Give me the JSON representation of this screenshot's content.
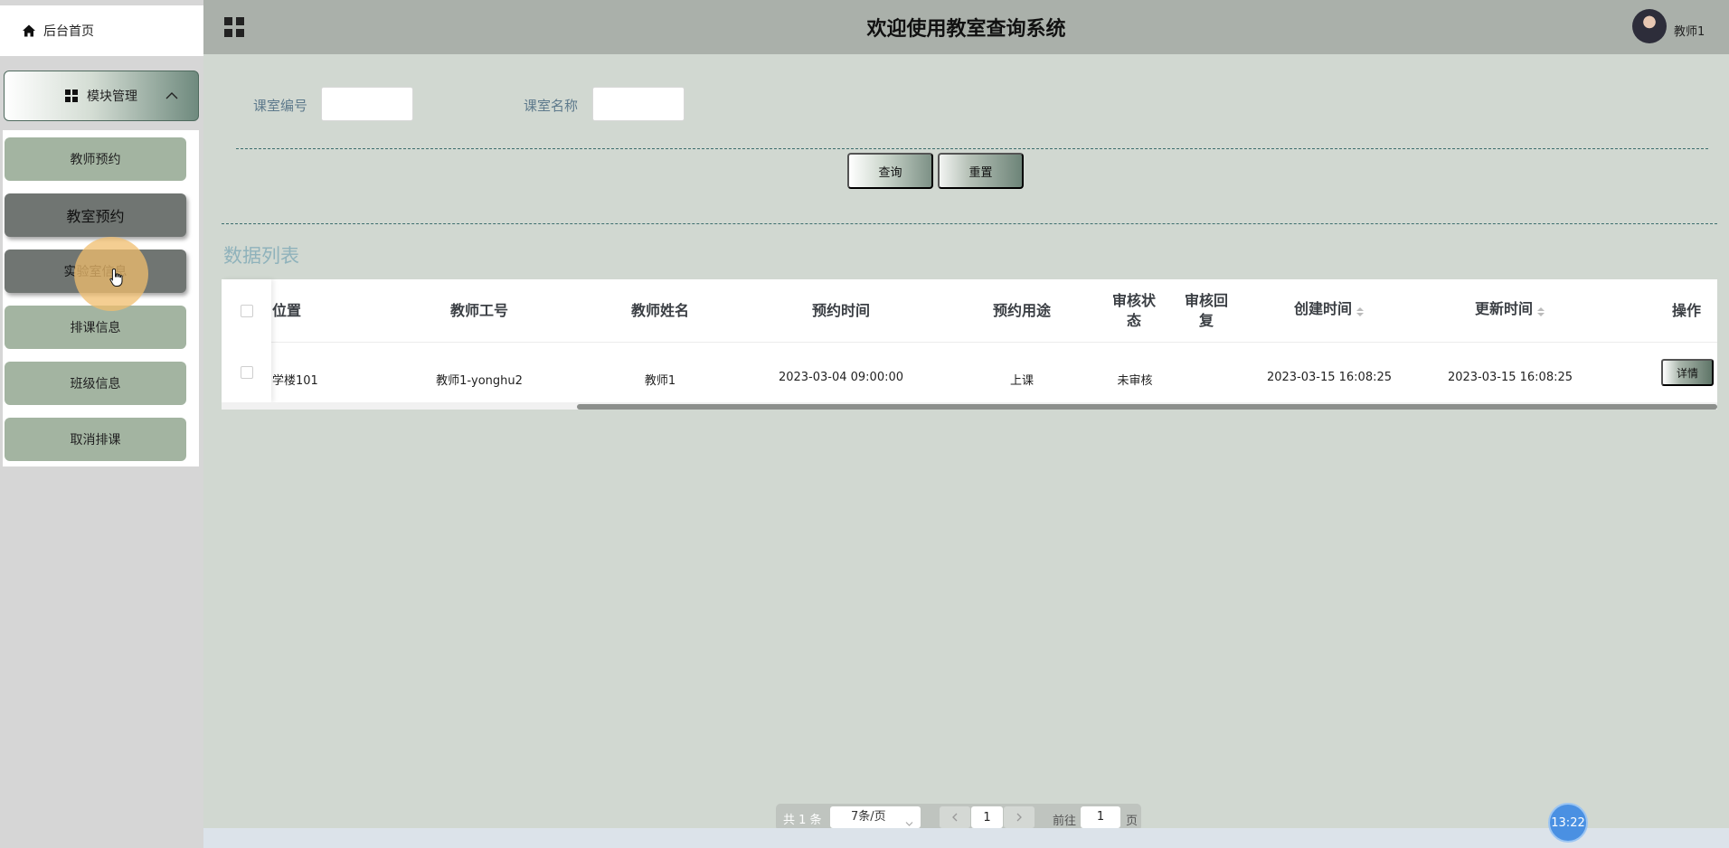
{
  "sidebar": {
    "home_label": "后台首页",
    "module_label": "模块管理",
    "items": [
      {
        "label": "教师预约"
      },
      {
        "label": "教室预约"
      },
      {
        "label": "实验室信息"
      },
      {
        "label": "排课信息"
      },
      {
        "label": "班级信息"
      },
      {
        "label": "取消排课"
      }
    ]
  },
  "header": {
    "title": "欢迎使用教室查询系统",
    "username": "教师1"
  },
  "search": {
    "room_no_label": "课室编号",
    "room_name_label": "课室名称",
    "room_no_value": "",
    "room_name_value": "",
    "query_label": "查询",
    "reset_label": "重置"
  },
  "list": {
    "title": "数据列表",
    "columns": [
      "位置",
      "教师工号",
      "教师姓名",
      "预约时间",
      "预约用途",
      "审核状态",
      "审核回复",
      "创建时间",
      "更新时间",
      "操作"
    ],
    "rows": [
      {
        "location": "学楼101",
        "teacher_no": "教师1-yonghu2",
        "teacher_name": "教师1",
        "reserve_time": "2023-03-04 09:00:00",
        "purpose": "上课",
        "status": "未审核",
        "reply": "",
        "created": "2023-03-15 16:08:25",
        "updated": "2023-03-15 16:08:25",
        "action_label": "详情"
      }
    ]
  },
  "pagination": {
    "total": "共 1 条",
    "page_size": "7条/页",
    "current": "1",
    "goto_label": "前往",
    "goto_value": "1",
    "page_word": "页"
  },
  "clock": "13:22",
  "colors": {
    "header_bg": "#aab0aa",
    "main_bg": "#d1d8d1",
    "sidebar_item": "#a3b4a1",
    "sidebar_item_active": "#707572",
    "label_blue": "#5e7a8c"
  }
}
